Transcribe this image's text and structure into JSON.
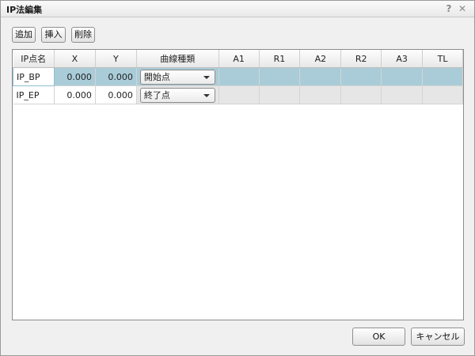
{
  "dialog": {
    "title": "IP法編集",
    "help_glyph": "?",
    "close_glyph": "✕"
  },
  "toolbar": {
    "add_label": "追加",
    "insert_label": "挿入",
    "delete_label": "削除"
  },
  "grid": {
    "columns": [
      "IP点名",
      "X",
      "Y",
      "曲線種類",
      "A1",
      "R1",
      "A2",
      "R2",
      "A3",
      "TL"
    ],
    "rows": [
      {
        "name": "IP_BP",
        "x": "0.000",
        "y": "0.000",
        "curve_type": "開始点",
        "a1": "",
        "r1": "",
        "a2": "",
        "r2": "",
        "a3": "",
        "tl": "",
        "selected": true
      },
      {
        "name": "IP_EP",
        "x": "0.000",
        "y": "0.000",
        "curve_type": "終了点",
        "a1": "",
        "r1": "",
        "a2": "",
        "r2": "",
        "a3": "",
        "tl": "",
        "selected": false
      }
    ]
  },
  "footer": {
    "ok_label": "OK",
    "cancel_label": "キャンセル"
  },
  "colors": {
    "selected_row": "#a9ccd8",
    "disabled_cell": "#e6e6e6"
  }
}
